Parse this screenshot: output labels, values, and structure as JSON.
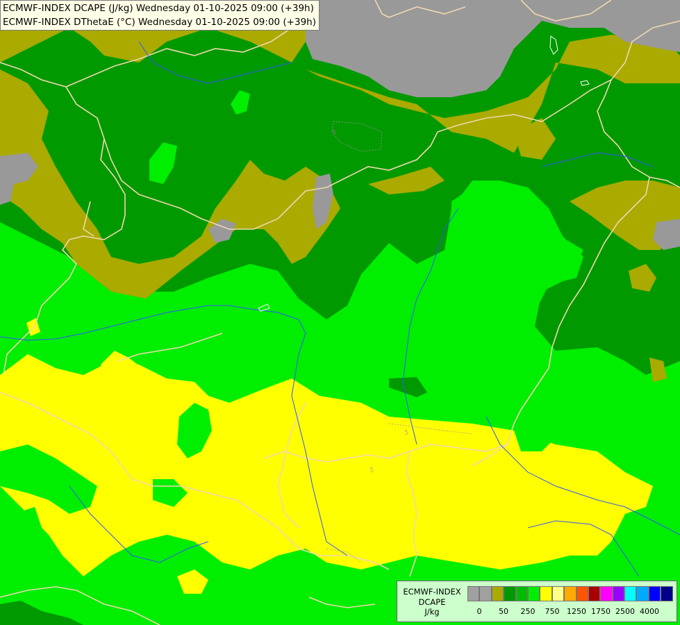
{
  "header": {
    "line1": "ECMWF-INDEX DCAPE (J/kg) Wednesday 01-10-2025 09:00 (+39h)",
    "line2": "ECMWF-INDEX DThetaE (°C) Wednesday 01-10-2025 09:00 (+39h)"
  },
  "legend": {
    "title_line1": "ECMWF-INDEX",
    "title_line2": "DCAPE",
    "unit": "J/kg",
    "swatch_colors": [
      "#a0a0a0",
      "#a0a0a0",
      "#aaaa00",
      "#009900",
      "#00bb00",
      "#00ee00",
      "#ffff00",
      "#ffff88",
      "#ffaa00",
      "#ff5500",
      "#aa0000",
      "#ff00ff",
      "#9900ff",
      "#00ffff",
      "#00aaff",
      "#0000ff",
      "#000088"
    ],
    "tick_labels": [
      "0",
      "50",
      "250",
      "750",
      "1250",
      "1750",
      "2500",
      "4000"
    ]
  },
  "contour_labels": [
    "5",
    "5",
    "5"
  ],
  "colors": {
    "no_data_gray": "#999999",
    "olive": "#aaaa00",
    "dark_green": "#009900",
    "bright_green": "#00ee00",
    "yellow": "#ffff00",
    "border": "#f0d8b0",
    "river": "#3355ff"
  }
}
